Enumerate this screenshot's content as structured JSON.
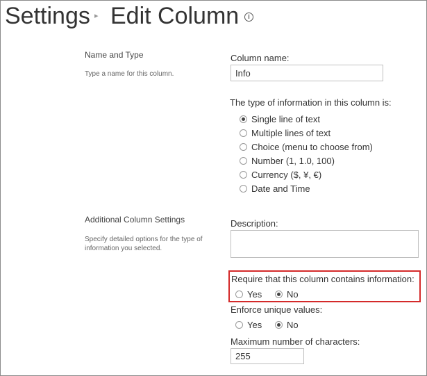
{
  "header": {
    "crumb": "Settings",
    "separator": "▸",
    "title": "Edit Column",
    "info_icon": "i"
  },
  "name_type_section": {
    "title": "Name and Type",
    "description": "Type a name for this column."
  },
  "column_name": {
    "label": "Column name:",
    "value": "Info"
  },
  "type_info": {
    "label": "The type of information in this column is:",
    "options": [
      {
        "label": "Single line of text",
        "selected": true
      },
      {
        "label": "Multiple lines of text",
        "selected": false
      },
      {
        "label": "Choice (menu to choose from)",
        "selected": false
      },
      {
        "label": "Number (1, 1.0, 100)",
        "selected": false
      },
      {
        "label": "Currency ($, ¥, €)",
        "selected": false
      },
      {
        "label": "Date and Time",
        "selected": false
      }
    ]
  },
  "additional_section": {
    "title": "Additional Column Settings",
    "description": "Specify detailed options for the type of information you selected."
  },
  "description_field": {
    "label": "Description:",
    "value": ""
  },
  "require_info": {
    "label": "Require that this column contains information:",
    "yes_label": "Yes",
    "no_label": "No",
    "selected": "No"
  },
  "unique_values": {
    "label": "Enforce unique values:",
    "yes_label": "Yes",
    "no_label": "No",
    "selected": "No"
  },
  "max_chars": {
    "label": "Maximum number of characters:",
    "value": "255"
  },
  "colors": {
    "highlight": "#d42a2a",
    "text": "#333333",
    "border": "#bfbfbf"
  }
}
